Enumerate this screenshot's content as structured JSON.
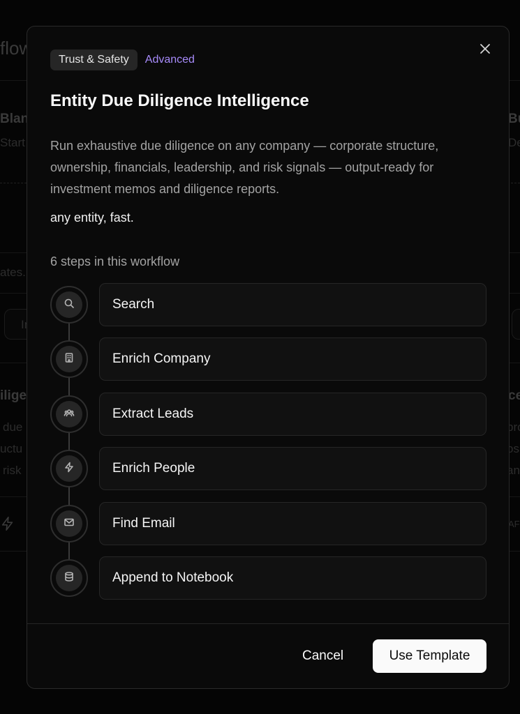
{
  "background": {
    "fragments": [
      "flow",
      "Blan",
      "Start",
      "Bu",
      "De",
      "ates.",
      "In",
      "ilige",
      "due",
      "uctu",
      "risk",
      "ce",
      "pro",
      "osu",
      "anc",
      "AFF"
    ]
  },
  "modal": {
    "category_tag": "Trust & Safety",
    "level_tag": "Advanced",
    "title": "Entity Due Diligence Intelligence",
    "description": "Run exhaustive due diligence on any company — corporate structure, ownership, financials, leadership, and risk signals — output-ready for investment memos and diligence reports.",
    "tagline": "any entity, fast.",
    "steps_heading": "6 steps in this workflow",
    "steps": [
      {
        "label": "Search",
        "icon": "search-icon"
      },
      {
        "label": "Enrich Company",
        "icon": "building-icon"
      },
      {
        "label": "Extract Leads",
        "icon": "users-icon"
      },
      {
        "label": "Enrich People",
        "icon": "lightning-icon"
      },
      {
        "label": "Find Email",
        "icon": "mail-icon"
      },
      {
        "label": "Append to Notebook",
        "icon": "database-icon"
      }
    ],
    "cancel_label": "Cancel",
    "use_label": "Use Template"
  },
  "colors": {
    "accent": "#a78bfa",
    "primary_button": "#fafafa",
    "modal_background": "#0a0a0a"
  }
}
